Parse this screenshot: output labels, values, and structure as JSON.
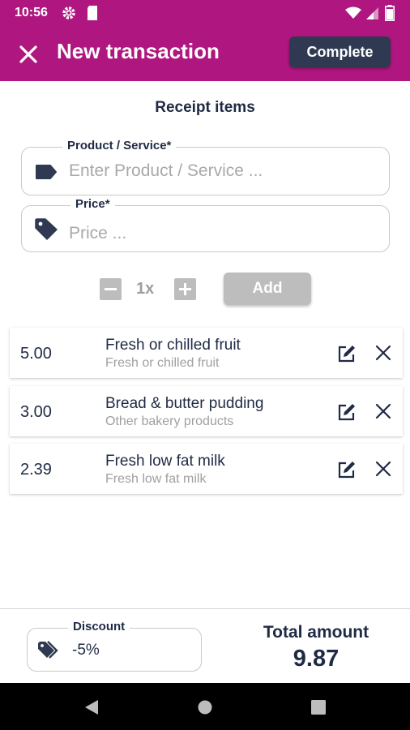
{
  "status_bar": {
    "time": "10:56"
  },
  "app_bar": {
    "title": "New transaction",
    "complete_label": "Complete"
  },
  "section_title": "Receipt items",
  "product_field": {
    "label": "Product / Service*",
    "placeholder": "Enter Product / Service ..."
  },
  "price_field": {
    "label": "Price*",
    "placeholder": "Price ..."
  },
  "stepper": {
    "quantity": "1x"
  },
  "add_label": "Add",
  "items": [
    {
      "price": "5.00",
      "name": "Fresh or chilled fruit",
      "category": "Fresh or chilled fruit"
    },
    {
      "price": "3.00",
      "name": "Bread & butter pudding",
      "category": "Other bakery products"
    },
    {
      "price": "2.39",
      "name": "Fresh low fat milk",
      "category": "Fresh low fat milk"
    }
  ],
  "discount": {
    "label": "Discount",
    "value": "-5%"
  },
  "total": {
    "label": "Total amount",
    "value": "9.87"
  },
  "colors": {
    "brand": "#b0167f",
    "accent_dark": "#2f3a52",
    "text": "#1f2a44",
    "disabled": "#bdbdbd"
  },
  "icons": [
    "settings-icon",
    "sd-card-icon",
    "wifi-icon",
    "signal-icon",
    "battery-icon",
    "close-icon",
    "label-icon",
    "price-tag-icon",
    "edit-icon",
    "remove-icon",
    "discount-tags-icon",
    "back-icon",
    "home-icon",
    "recents-icon"
  ]
}
